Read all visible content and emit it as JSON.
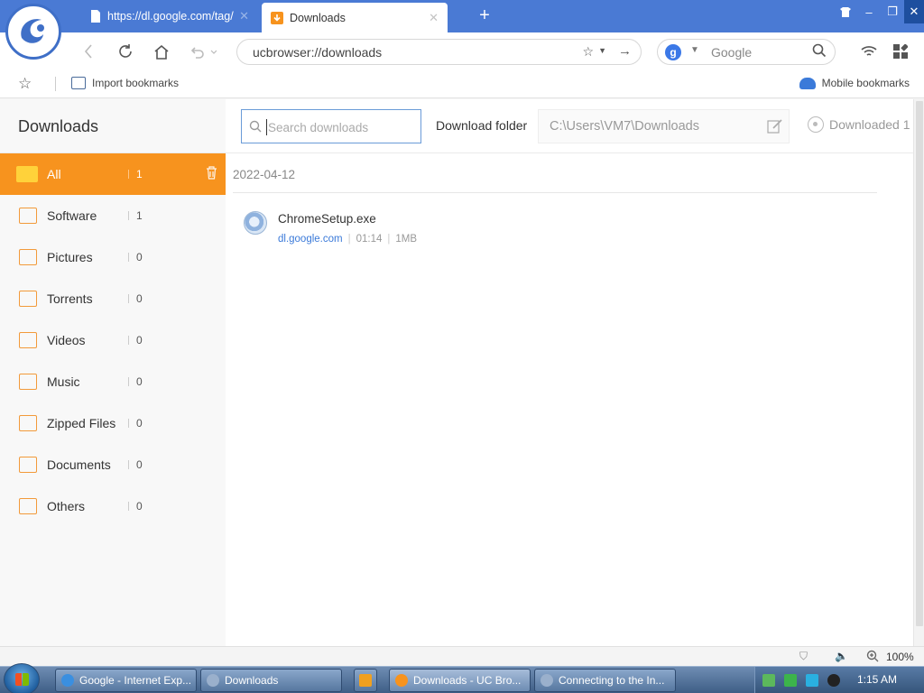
{
  "tabs": [
    {
      "label": "https://dl.google.com/tag/",
      "active": false
    },
    {
      "label": "Downloads",
      "active": true
    }
  ],
  "address": {
    "url": "ucbrowser://downloads"
  },
  "search_box": {
    "engine_badge": "g",
    "placeholder": "Google"
  },
  "bookmarks_bar": {
    "import_label": "Import bookmarks",
    "mobile_label": "Mobile bookmarks"
  },
  "sidebar": {
    "title": "Downloads",
    "categories": [
      {
        "label": "All",
        "count": "1",
        "active": true
      },
      {
        "label": "Software",
        "count": "1"
      },
      {
        "label": "Pictures",
        "count": "0"
      },
      {
        "label": "Torrents",
        "count": "0"
      },
      {
        "label": "Videos",
        "count": "0"
      },
      {
        "label": "Music",
        "count": "0"
      },
      {
        "label": "Zipped Files",
        "count": "0"
      },
      {
        "label": "Documents",
        "count": "0"
      },
      {
        "label": "Others",
        "count": "0"
      }
    ]
  },
  "toolbar": {
    "search_placeholder": "Search downloads",
    "folder_label": "Download folder",
    "folder_path": "C:\\Users\\VM7\\Downloads",
    "downloaded_status": "Downloaded 1"
  },
  "downloads": {
    "date": "2022-04-12",
    "items": [
      {
        "name": "ChromeSetup.exe",
        "source": "dl.google.com",
        "time": "01:14",
        "size": "1MB"
      }
    ]
  },
  "statusbar": {
    "zoom": "100%"
  },
  "taskbar": {
    "items": [
      {
        "label": "Google - Internet Exp..."
      },
      {
        "label": "Downloads"
      },
      {
        "label": "Downloads - UC Bro..."
      },
      {
        "label": "Connecting to the In..."
      }
    ],
    "clock": "1:15 AM"
  },
  "colors": {
    "accent": "#f7931e",
    "titlebar": "#4a7ad4",
    "link": "#3b7ad9"
  }
}
